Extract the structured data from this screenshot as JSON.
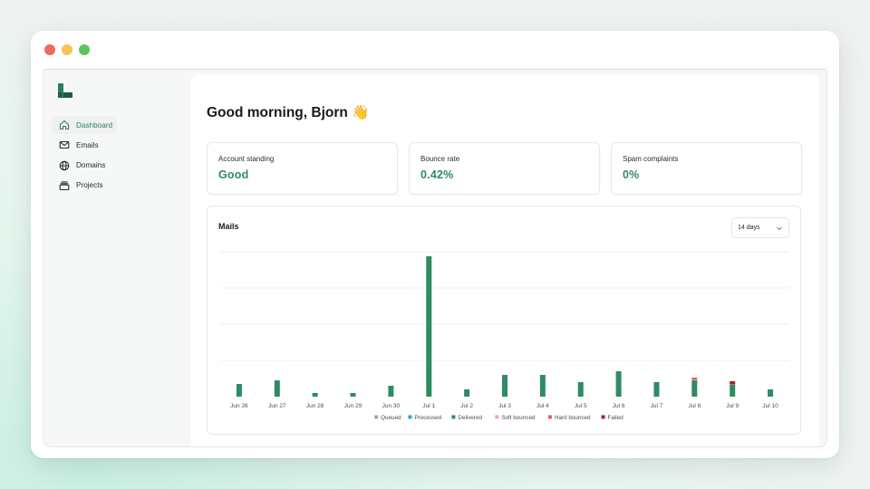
{
  "app": {
    "sidebar": {
      "items": [
        {
          "label": "Dashboard",
          "icon": "home-icon",
          "active": true
        },
        {
          "label": "Emails",
          "icon": "mail-icon"
        },
        {
          "label": "Domains",
          "icon": "globe-icon"
        },
        {
          "label": "Projects",
          "icon": "folder-icon"
        }
      ]
    },
    "greeting": "Good morning, Bjorn 👋",
    "stats": [
      {
        "label": "Account standing",
        "value": "Good"
      },
      {
        "label": "Bounce rate",
        "value": "0.42%"
      },
      {
        "label": "Spam complaints",
        "value": "0%"
      }
    ],
    "mails": {
      "title": "Mails",
      "range_label": "14 days"
    }
  },
  "colors": {
    "accent": "#2e8b63",
    "delivered": "#2e8b63",
    "processed": "#26a6c9",
    "queued": "#a3a8a6",
    "soft_bounced": "#f2a7a7",
    "hard_bounced": "#e35d5d",
    "failed": "#a8202a"
  },
  "chart_data": {
    "type": "bar",
    "stacked": true,
    "categories": [
      "Jun 26",
      "Jun 27",
      "Jun 28",
      "Jun 29",
      "Jun 30",
      "Jul 1",
      "Jul 2",
      "Jul 3",
      "Jul 4",
      "Jul 5",
      "Jul 6",
      "Jul 7",
      "Jul 8",
      "Jul 9",
      "Jul 10"
    ],
    "series": [
      {
        "name": "Queued",
        "color": "#a3a8a6",
        "values": [
          0,
          0,
          0,
          0,
          0,
          0,
          0,
          0,
          0,
          0,
          0,
          0,
          0,
          0,
          0
        ]
      },
      {
        "name": "Processed",
        "color": "#26a6c9",
        "values": [
          0,
          0,
          0,
          0,
          0,
          0,
          0,
          0,
          0,
          0,
          0,
          0,
          0,
          0,
          0
        ]
      },
      {
        "name": "Delivered",
        "color": "#2e8b63",
        "values": [
          14,
          18,
          4,
          4,
          12,
          155,
          8,
          24,
          24,
          16,
          28,
          16,
          18,
          13,
          8
        ]
      },
      {
        "name": "Soft bounced",
        "color": "#f2a7a7",
        "values": [
          0,
          0,
          0,
          0,
          0,
          0,
          0,
          0,
          0,
          0,
          0,
          0,
          1,
          0,
          0
        ]
      },
      {
        "name": "Hard bounced",
        "color": "#e35d5d",
        "values": [
          0,
          0,
          0,
          0,
          0,
          0,
          0,
          0,
          0,
          0,
          0,
          0,
          2,
          1,
          0
        ]
      },
      {
        "name": "Failed",
        "color": "#a8202a",
        "values": [
          0,
          0,
          0,
          0,
          0,
          0,
          0,
          0,
          0,
          0,
          0,
          0,
          0,
          3,
          0
        ]
      }
    ],
    "ylim": [
      0,
      160
    ],
    "grid": true,
    "legend_position": "bottom",
    "title": "Mails"
  }
}
